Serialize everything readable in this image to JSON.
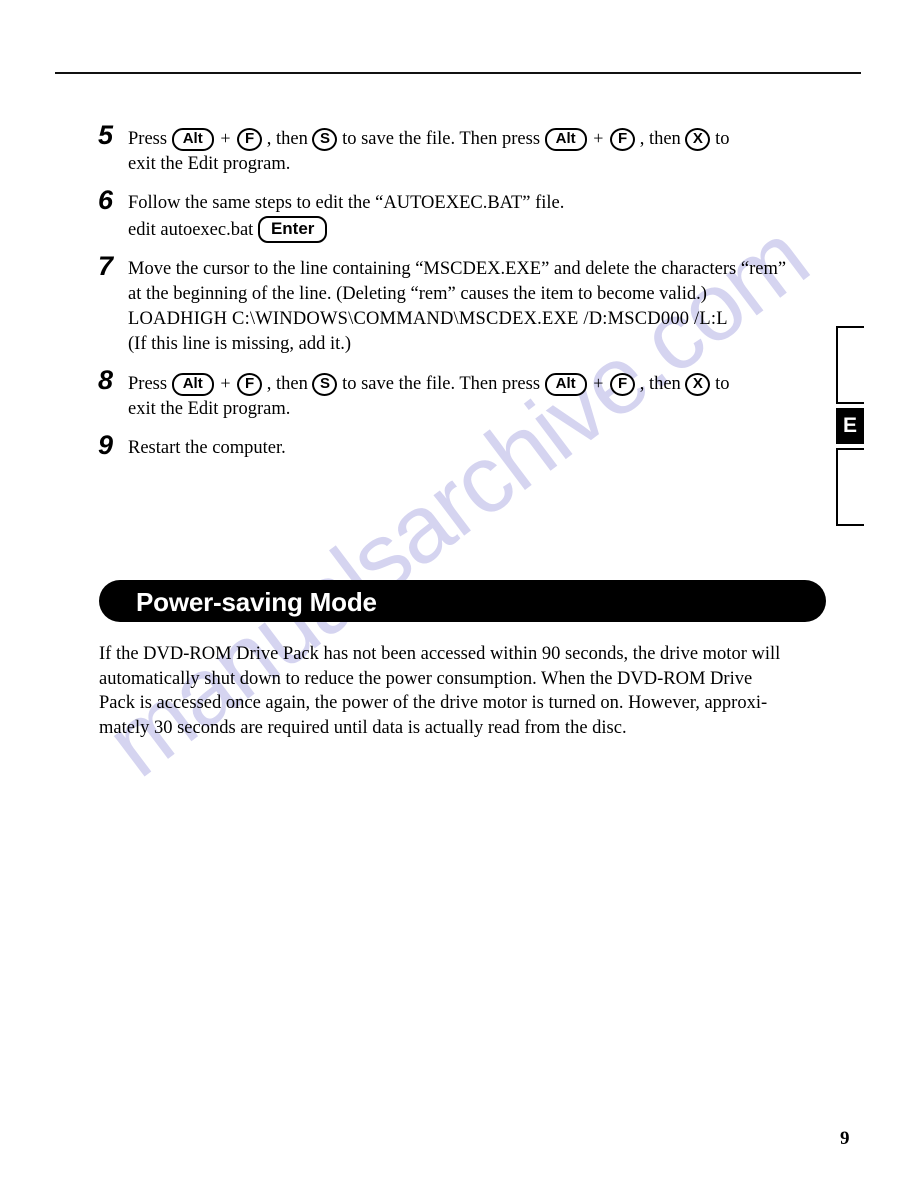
{
  "page": {
    "number": "9",
    "tab_index": {
      "active_label": "E"
    }
  },
  "steps": [
    {
      "number": "5",
      "lines": [
        {
          "segments": [
            {
              "type": "text",
              "text": "Press"
            },
            {
              "type": "key",
              "shape": "oval",
              "label": "Alt"
            },
            {
              "type": "text",
              "text": "+"
            },
            {
              "type": "key",
              "shape": "round",
              "label": "F"
            },
            {
              "type": "text",
              "text": ", then"
            },
            {
              "type": "key",
              "shape": "round",
              "label": "S"
            },
            {
              "type": "text",
              "text": "to save the file.  Then press"
            },
            {
              "type": "key",
              "shape": "oval",
              "label": "Alt"
            },
            {
              "type": "text",
              "text": "+"
            },
            {
              "type": "key",
              "shape": "round",
              "label": "F"
            },
            {
              "type": "text",
              "text": ", then"
            },
            {
              "type": "key",
              "shape": "round",
              "label": "X"
            },
            {
              "type": "text",
              "text": "to"
            }
          ]
        },
        {
          "segments": [
            {
              "type": "text",
              "text": "exit the Edit program."
            }
          ]
        }
      ]
    },
    {
      "number": "6",
      "lines": [
        {
          "segments": [
            {
              "type": "text",
              "text": "Follow the same steps to edit the “AUTOEXEC.BAT” file."
            }
          ]
        },
        {
          "segments": [
            {
              "type": "text",
              "text": "edit autoexec.bat"
            },
            {
              "type": "key",
              "shape": "rect",
              "label": "Enter"
            }
          ]
        }
      ]
    },
    {
      "number": "7",
      "lines": [
        {
          "segments": [
            {
              "type": "text",
              "text": "Move the cursor to the line containing “MSCDEX.EXE” and delete the characters “rem”"
            }
          ]
        },
        {
          "segments": [
            {
              "type": "text",
              "text": "at the beginning of the line. (Deleting “rem” causes the item to become valid.)"
            }
          ]
        },
        {
          "segments": [
            {
              "type": "command",
              "text": "LOADHIGH  C:\\WINDOWS\\COMMAND\\MSCDEX.EXE /D:MSCD000 /L:L"
            }
          ]
        },
        {
          "segments": [
            {
              "type": "text",
              "text": "(If this line is missing, add it.)"
            }
          ]
        }
      ]
    },
    {
      "number": "8",
      "lines": [
        {
          "segments": [
            {
              "type": "text",
              "text": "Press"
            },
            {
              "type": "key",
              "shape": "oval",
              "label": "Alt"
            },
            {
              "type": "text",
              "text": "+"
            },
            {
              "type": "key",
              "shape": "round",
              "label": "F"
            },
            {
              "type": "text",
              "text": ", then"
            },
            {
              "type": "key",
              "shape": "round",
              "label": "S"
            },
            {
              "type": "text",
              "text": "to save the file.  Then press"
            },
            {
              "type": "key",
              "shape": "oval",
              "label": "Alt"
            },
            {
              "type": "text",
              "text": "+"
            },
            {
              "type": "key",
              "shape": "round",
              "label": "F"
            },
            {
              "type": "text",
              "text": ", then"
            },
            {
              "type": "key",
              "shape": "round",
              "label": "X"
            },
            {
              "type": "text",
              "text": "to"
            }
          ]
        },
        {
          "segments": [
            {
              "type": "text",
              "text": "exit the Edit program."
            }
          ]
        }
      ]
    },
    {
      "number": "9",
      "lines": [
        {
          "segments": [
            {
              "type": "text",
              "text": "Restart the computer."
            }
          ]
        }
      ]
    }
  ],
  "section": {
    "banner_title": "Power-saving Mode",
    "paragraph_lines": [
      "If the DVD-ROM Drive Pack has not been accessed within 90 seconds, the drive motor will",
      "automatically shut down to reduce the power consumption.  When the DVD-ROM Drive",
      "Pack is accessed once again, the power of the drive motor is turned on.  However, approxi-",
      "mately 30 seconds are required until data is actually read from the disc."
    ]
  },
  "watermark": {
    "text": "manualsarchive.com",
    "color": "#d5d4f0"
  }
}
